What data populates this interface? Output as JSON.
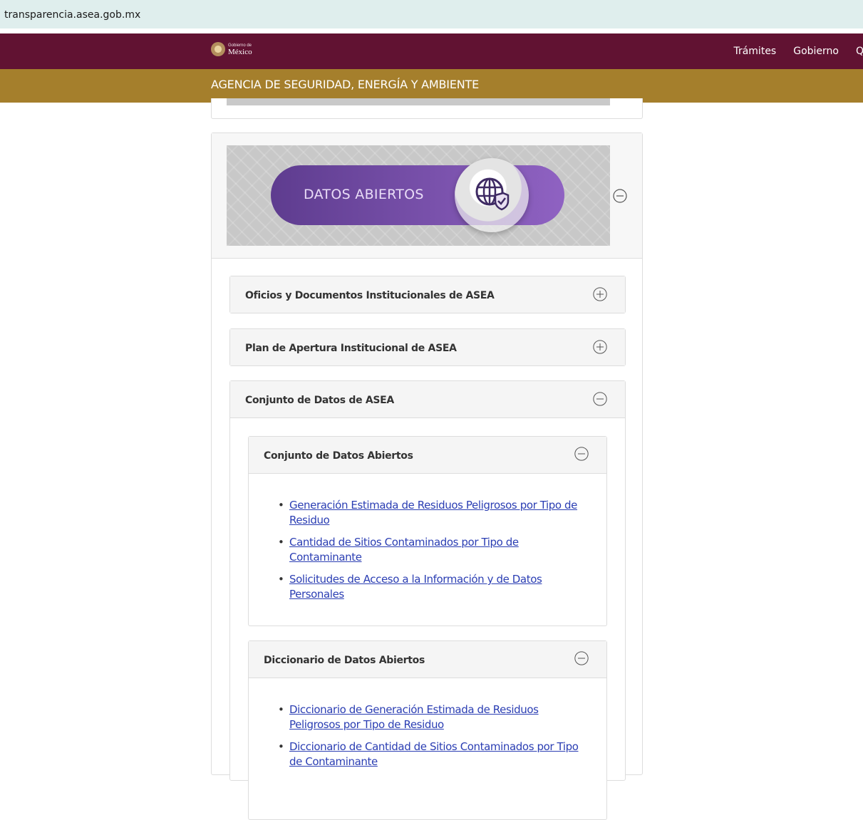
{
  "browser": {
    "url": "transparencia.asea.gob.mx"
  },
  "topnav": {
    "logo_small": "Gobierno de",
    "logo_big": "México",
    "links": [
      "Trámites",
      "Gobierno"
    ],
    "search_glyph": "Q"
  },
  "agency": {
    "title": "AGENCIA DE SEGURIDAD, ENERGÍA Y AMBIENTE"
  },
  "panel": {
    "banner_label": "DATOS ABIERTOS",
    "banner_icon": "globe-shield-icon",
    "state": "expanded"
  },
  "sections": {
    "oficios": {
      "title": "Oficios y Documentos Institucionales de ASEA",
      "state": "collapsed"
    },
    "plan": {
      "title": "Plan de Apertura Institucional de ASEA",
      "state": "collapsed"
    },
    "conjunto": {
      "title": "Conjunto de Datos de ASEA",
      "state": "expanded",
      "sub1": {
        "title": "Conjunto de Datos Abiertos",
        "links": [
          {
            "line1": "Generación Estimada de Residuos Peligrosos por Tipo de",
            "line2": "Residuo"
          },
          {
            "line1": "Cantidad de Sitios Contaminados por Tipo de",
            "line2": "Contaminante"
          },
          {
            "line1": "Solicitudes de Acceso a la Información y de Datos",
            "line2": "Personales"
          }
        ]
      },
      "sub2": {
        "title": "Diccionario de Datos Abiertos",
        "links": [
          {
            "line1": "Diccionario de Generación Estimada de Residuos",
            "line2": "Peligrosos por Tipo de Residuo"
          },
          {
            "line1": "Diccionario de Cantidad de Sitios Contaminados por Tipo",
            "line2": "de Contaminante"
          }
        ]
      }
    }
  },
  "colors": {
    "nav_bg": "#611232",
    "agency_bg": "#a57f2c",
    "url_bar_bg": "#dfeeed",
    "link": "#2b3eb3",
    "pill": "#7b50ad"
  }
}
